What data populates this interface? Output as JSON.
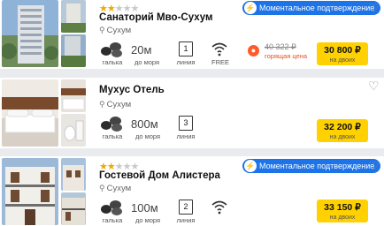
{
  "hotels": [
    {
      "name": "Санаторий Мво-Сухум",
      "stars_on": "★★",
      "stars_off": "★★★",
      "badge": "Моментальное подтверждение",
      "city": "Сухум",
      "surface_label": "галька",
      "distance": "20м",
      "distance_label": "до моря",
      "line": "1",
      "line_label": "линия",
      "wifi_label": "FREE",
      "old_price": "40 322 ₽",
      "hot_label": "горящая цена",
      "price": "30 800 ₽",
      "price_sub": "на двоих"
    },
    {
      "name": "Мухус Отель",
      "city": "Сухум",
      "surface_label": "галька",
      "distance": "800м",
      "distance_label": "до моря",
      "line": "3",
      "line_label": "линия",
      "price": "32 200 ₽",
      "price_sub": "на двоих"
    },
    {
      "name": "Гостевой Дом Алистера",
      "stars_on": "★★",
      "stars_off": "★★★",
      "badge": "Моментальное подтверждение",
      "city": "Сухум",
      "surface_label": "галька",
      "distance": "100м",
      "distance_label": "до моря",
      "line": "2",
      "line_label": "линия",
      "price": "33 150 ₽",
      "price_sub": "на двоих"
    }
  ],
  "icons": {
    "bolt": "⚡",
    "heart": "♡",
    "pin": "⚲",
    "fire": "🔥"
  },
  "colors": {
    "badge": "#1d73e8",
    "price_button": "#ffd100",
    "stars": "#f2a700",
    "hot": "#e8501d"
  }
}
